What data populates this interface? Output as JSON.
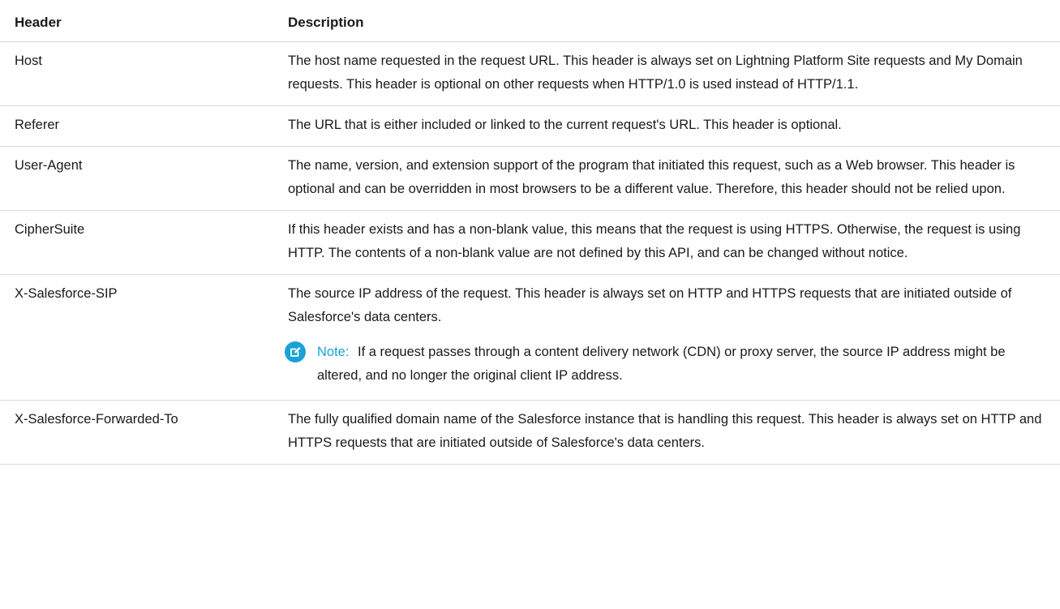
{
  "table": {
    "headers": {
      "header": "Header",
      "description": "Description"
    },
    "rows": [
      {
        "header": "Host",
        "description": "The host name requested in the request URL. This header is always set on Lightning Platform Site requests and My Domain requests. This header is optional on other requests when HTTP/1.0 is used instead of HTTP/1.1."
      },
      {
        "header": "Referer",
        "description": "The URL that is either included or linked to the current request's URL. This header is optional."
      },
      {
        "header": "User-Agent",
        "description": "The name, version, and extension support of the program that initiated this request, such as a Web browser. This header is optional and can be overridden in most browsers to be a different value. Therefore, this header should not be relied upon."
      },
      {
        "header": "CipherSuite",
        "description": "If this header exists and has a non-blank value, this means that the request is using HTTPS. Otherwise, the request is using HTTP. The contents of a non-blank value are not defined by this API, and can be changed without notice."
      },
      {
        "header": "X-Salesforce-SIP",
        "description": "The source IP address of the request. This header is always set on HTTP and HTTPS requests that are initiated outside of Salesforce's data centers.",
        "note": {
          "label": "Note:",
          "text": "If a request passes through a content delivery network (CDN) or proxy server, the source IP address might be altered, and no longer the original client IP address.",
          "icon": "edit-note-icon"
        }
      },
      {
        "header": "X-Salesforce-Forwarded-To",
        "description": "The fully qualified domain name of the Salesforce instance that is handling this request. This header is always set on HTTP and HTTPS requests that are initiated outside of Salesforce's data centers."
      }
    ]
  },
  "colors": {
    "note_accent": "#1aa1d6",
    "border": "#d8d8d8",
    "text": "#1a1a1a"
  }
}
